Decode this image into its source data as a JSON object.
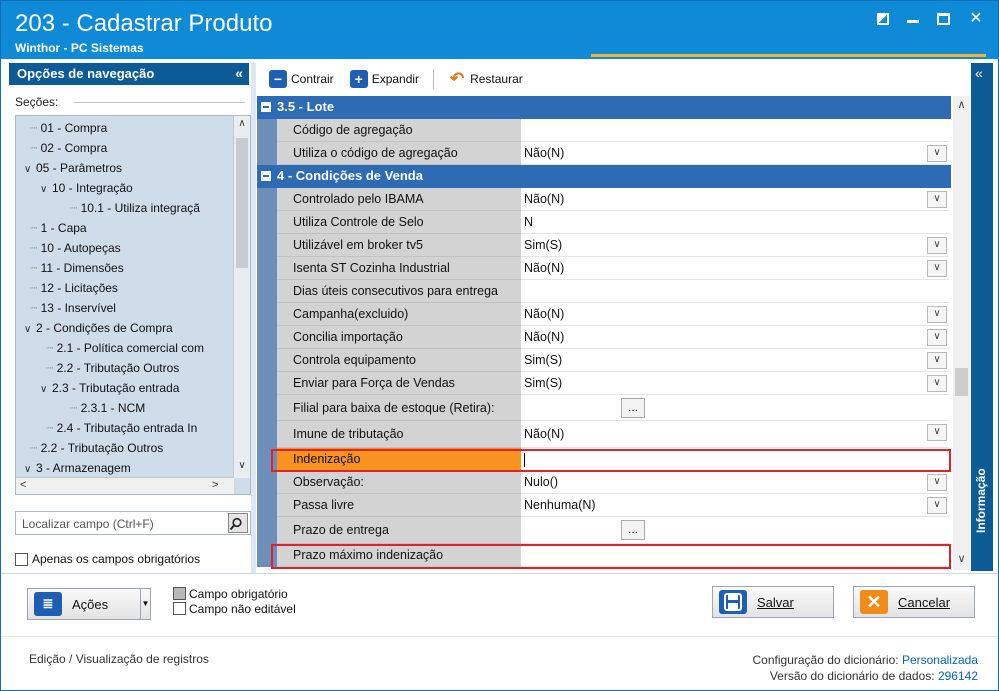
{
  "window": {
    "title": "203 - Cadastrar  Produto",
    "subtitle": "Winthor - PC Sistemas"
  },
  "nav": {
    "header": "Opções de navegação",
    "collapse_glyph": "«",
    "sections_label": "Seções:",
    "tree": [
      {
        "label": "01 - Compra",
        "level": 0,
        "expander": ""
      },
      {
        "label": "02 - Compra",
        "level": 0,
        "expander": ""
      },
      {
        "label": "05 - Parâmetros",
        "level": 0,
        "expander": "v"
      },
      {
        "label": "10 - Integração",
        "level": 1,
        "expander": "v"
      },
      {
        "label": "10.1 - Utiliza integraçã",
        "level": 2,
        "expander": ""
      },
      {
        "label": "1 - Capa",
        "level": 0,
        "expander": ""
      },
      {
        "label": "10 - Autopeças",
        "level": 0,
        "expander": ""
      },
      {
        "label": "11 - Dimensões",
        "level": 0,
        "expander": ""
      },
      {
        "label": "12 - Licitações",
        "level": 0,
        "expander": ""
      },
      {
        "label": "13 - Inservível",
        "level": 0,
        "expander": ""
      },
      {
        "label": "2 - Condições de Compra",
        "level": 0,
        "expander": "v"
      },
      {
        "label": "2.1 - Política comercial com",
        "level": 1,
        "expander": ""
      },
      {
        "label": "2.2 - Tributação Outros",
        "level": 1,
        "expander": ""
      },
      {
        "label": "2.3 - Tributação entrada",
        "level": 1,
        "expander": "v"
      },
      {
        "label": "2.3.1 - NCM",
        "level": 2,
        "expander": ""
      },
      {
        "label": "2.4 - Tributação entrada In",
        "level": 1,
        "expander": ""
      },
      {
        "label": "2.2 - Tributação Outros",
        "level": 0,
        "expander": ""
      },
      {
        "label": "3 - Armazenagem",
        "level": 0,
        "expander": "v"
      }
    ],
    "search_placeholder": "Localizar campo (Ctrl+F)",
    "required_only_label": "Apenas os campos obrigatórios"
  },
  "toolbar": {
    "collapse_label": "Contrair",
    "expand_label": "Expandir",
    "restore_label": "Restaurar"
  },
  "grid": {
    "groups": [
      {
        "title": "3.5 - Lote",
        "rows": [
          {
            "label": "Código de agregação",
            "value": "",
            "type": "text"
          },
          {
            "label": "Utiliza o código de agregação",
            "value": "Não(N)",
            "type": "dropdown"
          }
        ]
      },
      {
        "title": "4 - Condições de Venda",
        "rows": [
          {
            "label": "Controlado pelo IBAMA",
            "value": "Não(N)",
            "type": "dropdown"
          },
          {
            "label": "Utiliza Controle de Selo",
            "value": "N",
            "type": "text"
          },
          {
            "label": "Utilizável em broker tv5",
            "value": "Sim(S)",
            "type": "dropdown"
          },
          {
            "label": "Isenta ST Cozinha Industrial",
            "value": "Não(N)",
            "type": "dropdown"
          },
          {
            "label": "Dias úteis consecutivos para entrega",
            "value": "",
            "type": "text"
          },
          {
            "label": "Campanha(excluido)",
            "value": "Não(N)",
            "type": "dropdown"
          },
          {
            "label": "Concilia importação",
            "value": "Não(N)",
            "type": "dropdown"
          },
          {
            "label": "Controla equipamento",
            "value": "Sim(S)",
            "type": "dropdown"
          },
          {
            "label": "Enviar para Força de Vendas",
            "value": "Sim(S)",
            "type": "dropdown"
          },
          {
            "label": "Filial para baixa de estoque (Retira):",
            "value": "",
            "type": "ellipsis"
          },
          {
            "label": "Imune de tributação",
            "value": "Não(N)",
            "type": "dropdown"
          },
          {
            "label": "Indenização",
            "value": "",
            "type": "text",
            "selected": true
          },
          {
            "label": "Observação:",
            "value": "Nulo()",
            "type": "dropdown"
          },
          {
            "label": "Passa livre",
            "value": "Nenhuma(N)",
            "type": "dropdown"
          },
          {
            "label": "Prazo de entrega",
            "value": "",
            "type": "ellipsis"
          },
          {
            "label": "Prazo máximo indenização",
            "value": "",
            "type": "text"
          }
        ]
      }
    ]
  },
  "info_panel": {
    "label": "Informação",
    "chevron": "«"
  },
  "bottom": {
    "actions_label": "Ações",
    "legend_required": "Campo obrigatório",
    "legend_noneditable": "Campo não editável",
    "save_label": "Salvar",
    "cancel_label": "Cancelar",
    "status_left": "Edição / Visualização de registros",
    "dict_config_label": "Configuração do dicionário:",
    "dict_config_value": "Personalizada",
    "dict_version_label": "Versão do dicionário de dados:",
    "dict_version_value": "296142"
  },
  "colors": {
    "titlebar": "#0e8ad6",
    "nav_header": "#0c5a96",
    "group_header": "#2e6bb5",
    "selected_row": "#f7931e",
    "highlight_box": "#e0212e"
  }
}
